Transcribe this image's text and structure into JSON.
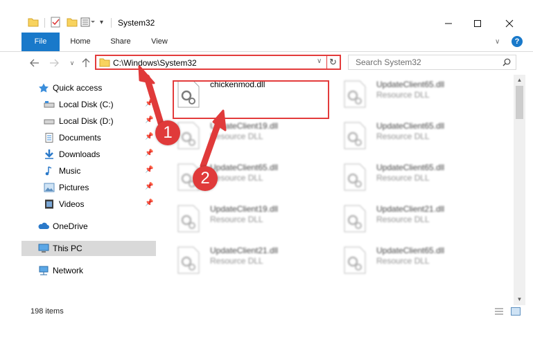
{
  "window": {
    "title": "System32"
  },
  "titlebar": {
    "minimize_icon": "minimize-icon",
    "maximize_icon": "maximize-icon",
    "close_icon": "close-icon"
  },
  "ribbon": {
    "tabs": [
      "File",
      "Home",
      "Share",
      "View"
    ],
    "help_glyph": "?"
  },
  "nav": {
    "address": "C:\\Windows\\System32",
    "search_placeholder": "Search System32"
  },
  "sidebar": {
    "items": [
      {
        "label": "Quick access",
        "icon": "star-icon",
        "pinned": false
      },
      {
        "label": "Local Disk (C:)",
        "icon": "drive-icon",
        "pinned": true
      },
      {
        "label": "Local Disk (D:)",
        "icon": "drive-icon",
        "pinned": true
      },
      {
        "label": "Documents",
        "icon": "documents-icon",
        "pinned": true
      },
      {
        "label": "Downloads",
        "icon": "download-icon",
        "pinned": true
      },
      {
        "label": "Music",
        "icon": "music-icon",
        "pinned": true
      },
      {
        "label": "Pictures",
        "icon": "pictures-icon",
        "pinned": true
      },
      {
        "label": "Videos",
        "icon": "videos-icon",
        "pinned": true
      },
      {
        "label": "OneDrive",
        "icon": "cloud-icon",
        "pinned": false
      },
      {
        "label": "This PC",
        "icon": "computer-icon",
        "pinned": false,
        "selected": true
      },
      {
        "label": "Network",
        "icon": "network-icon",
        "pinned": false
      }
    ]
  },
  "files": [
    {
      "name": "chickenmod.dll",
      "type": "",
      "highlighted": true
    },
    {
      "name": "UpdateClient65.dll",
      "type": "Resource DLL"
    },
    {
      "name": "UpdateClient19.dll",
      "type": "Resource DLL"
    },
    {
      "name": "UpdateClient65.dll",
      "type": "Resource DLL"
    },
    {
      "name": "UpdateClient65.dll",
      "type": "Resource DLL"
    },
    {
      "name": "UpdateClient65.dll",
      "type": "Resource DLL"
    },
    {
      "name": "UpdateClient19.dll",
      "type": "Resource DLL"
    },
    {
      "name": "UpdateClient21.dll",
      "type": "Resource DLL"
    },
    {
      "name": "UpdateClient21.dll",
      "type": "Resource DLL"
    },
    {
      "name": "UpdateClient65.dll",
      "type": "Resource DLL"
    }
  ],
  "status": {
    "item_count": "198 items"
  },
  "callouts": [
    "1",
    "2"
  ],
  "colors": {
    "accent": "#1979ca",
    "highlight": "#e33b3b"
  }
}
